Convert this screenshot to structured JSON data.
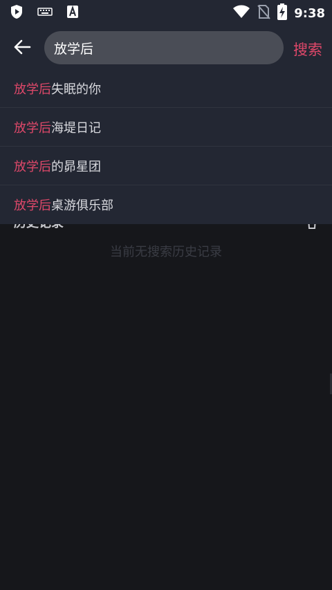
{
  "status_bar": {
    "time": "9:38",
    "icons": [
      "play-protect-icon",
      "keyboard-icon",
      "font-a-icon",
      "wifi-icon",
      "no-sim-icon",
      "battery-charging-icon"
    ]
  },
  "header": {
    "back_icon": "arrow-left-icon",
    "search_value": "放学后",
    "search_button_label": "搜索"
  },
  "suggestions": [
    {
      "keyword": "放学后",
      "rest": "失眠的你"
    },
    {
      "keyword": "放学后",
      "rest": "海堤日记"
    },
    {
      "keyword": "放学后",
      "rest": "的昴星团"
    },
    {
      "keyword": "放学后",
      "rest": "桌游俱乐部"
    }
  ],
  "history": {
    "title": "历史记录",
    "empty_text": "当前无搜索历史记录",
    "clear_icon": "trash-icon"
  },
  "colors": {
    "accent": "#e0486a",
    "bar": "#232733",
    "background": "#16171b",
    "search_box": "#4a4d56"
  }
}
